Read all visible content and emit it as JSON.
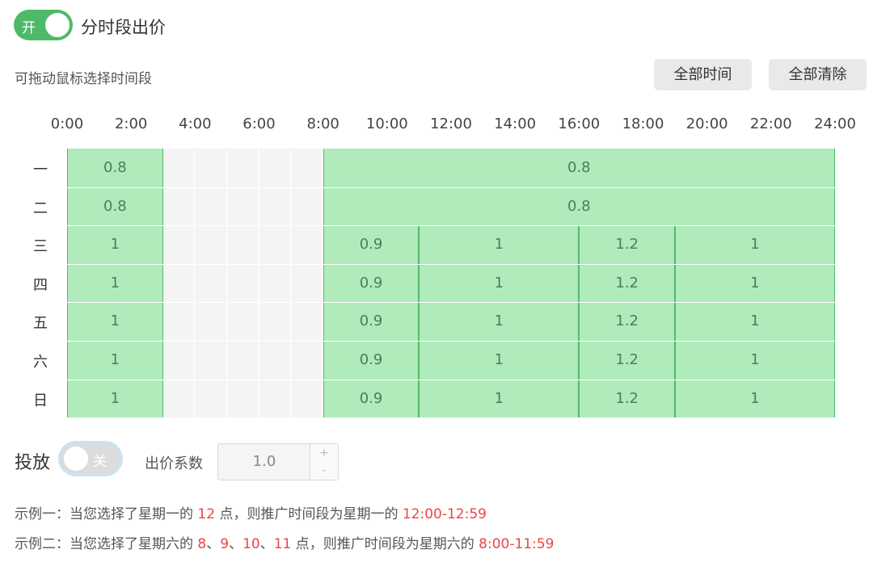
{
  "header": {
    "switch_label": "开",
    "title": "分时段出价"
  },
  "hint": "可拖动鼠标选择时间段",
  "buttons": {
    "select_all": "全部时间",
    "clear_all": "全部清除"
  },
  "hours": [
    "0:00",
    "2:00",
    "4:00",
    "6:00",
    "8:00",
    "10:00",
    "12:00",
    "14:00",
    "16:00",
    "18:00",
    "20:00",
    "22:00",
    "24:00"
  ],
  "days": [
    "一",
    "二",
    "三",
    "四",
    "五",
    "六",
    "日"
  ],
  "schedule": [
    [
      {
        "start": 0,
        "end": 3,
        "value": "0.8"
      },
      {
        "start": 8,
        "end": 24,
        "value": "0.8"
      }
    ],
    [
      {
        "start": 0,
        "end": 3,
        "value": "0.8"
      },
      {
        "start": 8,
        "end": 24,
        "value": "0.8"
      }
    ],
    [
      {
        "start": 0,
        "end": 3,
        "value": "1"
      },
      {
        "start": 8,
        "end": 11,
        "value": "0.9"
      },
      {
        "start": 11,
        "end": 16,
        "value": "1"
      },
      {
        "start": 16,
        "end": 19,
        "value": "1.2"
      },
      {
        "start": 19,
        "end": 24,
        "value": "1"
      }
    ],
    [
      {
        "start": 0,
        "end": 3,
        "value": "1"
      },
      {
        "start": 8,
        "end": 11,
        "value": "0.9"
      },
      {
        "start": 11,
        "end": 16,
        "value": "1"
      },
      {
        "start": 16,
        "end": 19,
        "value": "1.2"
      },
      {
        "start": 19,
        "end": 24,
        "value": "1"
      }
    ],
    [
      {
        "start": 0,
        "end": 3,
        "value": "1"
      },
      {
        "start": 8,
        "end": 11,
        "value": "0.9"
      },
      {
        "start": 11,
        "end": 16,
        "value": "1"
      },
      {
        "start": 16,
        "end": 19,
        "value": "1.2"
      },
      {
        "start": 19,
        "end": 24,
        "value": "1"
      }
    ],
    [
      {
        "start": 0,
        "end": 3,
        "value": "1"
      },
      {
        "start": 8,
        "end": 11,
        "value": "0.9"
      },
      {
        "start": 11,
        "end": 16,
        "value": "1"
      },
      {
        "start": 16,
        "end": 19,
        "value": "1.2"
      },
      {
        "start": 19,
        "end": 24,
        "value": "1"
      }
    ],
    [
      {
        "start": 0,
        "end": 3,
        "value": "1"
      },
      {
        "start": 8,
        "end": 11,
        "value": "0.9"
      },
      {
        "start": 11,
        "end": 16,
        "value": "1"
      },
      {
        "start": 16,
        "end": 19,
        "value": "1.2"
      },
      {
        "start": 19,
        "end": 24,
        "value": "1"
      }
    ]
  ],
  "controls": {
    "put_label": "投放",
    "put_switch_label": "关",
    "coef_label": "出价系数",
    "coef_value": "1.0",
    "inc": "+",
    "dec": "-"
  },
  "examples": [
    {
      "parts": [
        {
          "t": "示例一：当您选择了星期一的 ",
          "red": false
        },
        {
          "t": "12",
          "red": true
        },
        {
          "t": " 点，则推广时间段为星期一的 ",
          "red": false
        },
        {
          "t": "12:00-12:59",
          "red": true
        }
      ]
    },
    {
      "parts": [
        {
          "t": "示例二：当您选择了星期六的 ",
          "red": false
        },
        {
          "t": "8",
          "red": true
        },
        {
          "t": "、",
          "red": false
        },
        {
          "t": "9",
          "red": true
        },
        {
          "t": "、",
          "red": false
        },
        {
          "t": "10",
          "red": true
        },
        {
          "t": "、",
          "red": false
        },
        {
          "t": "11",
          "red": true
        },
        {
          "t": " 点，则推广时间段为星期六的 ",
          "red": false
        },
        {
          "t": "8:00-11:59",
          "red": true
        }
      ]
    }
  ],
  "colors": {
    "accent": "#4fb96a",
    "selected": "#b0ebbc",
    "empty": "#f4f4f4",
    "highlight": "#ee4444"
  }
}
